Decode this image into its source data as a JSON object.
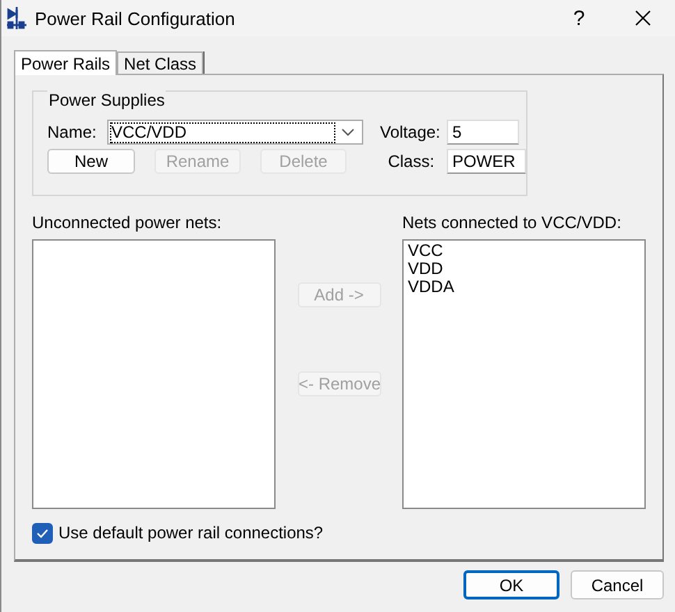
{
  "window": {
    "title": "Power Rail Configuration",
    "help": "?"
  },
  "tabs": [
    {
      "label": "Power Rails",
      "selected": true
    },
    {
      "label": "Net Class",
      "selected": false
    }
  ],
  "power_supplies": {
    "title": "Power Supplies",
    "name_label": "Name:",
    "name_value": "VCC/VDD",
    "voltage_label": "Voltage:",
    "voltage_value": "5",
    "class_label": "Class:",
    "class_value": "POWER",
    "buttons": [
      {
        "label": "New",
        "disabled": false
      },
      {
        "label": "Rename",
        "disabled": true
      },
      {
        "label": "Delete",
        "disabled": true
      }
    ]
  },
  "unconnected": {
    "label": "Unconnected power nets:"
  },
  "connected": {
    "label": "Nets connected to VCC/VDD:",
    "items": [
      "VCC",
      "VDD",
      "VDDA"
    ]
  },
  "move_buttons": [
    {
      "label": "Add ->",
      "disabled": true
    },
    {
      "label": "<- Remove",
      "disabled": true
    }
  ],
  "default_connections": {
    "label": "Use default power rail connections?",
    "checked": true
  },
  "dialog_buttons": [
    {
      "label": "OK",
      "default": true
    },
    {
      "label": "Cancel",
      "default": false
    }
  ]
}
